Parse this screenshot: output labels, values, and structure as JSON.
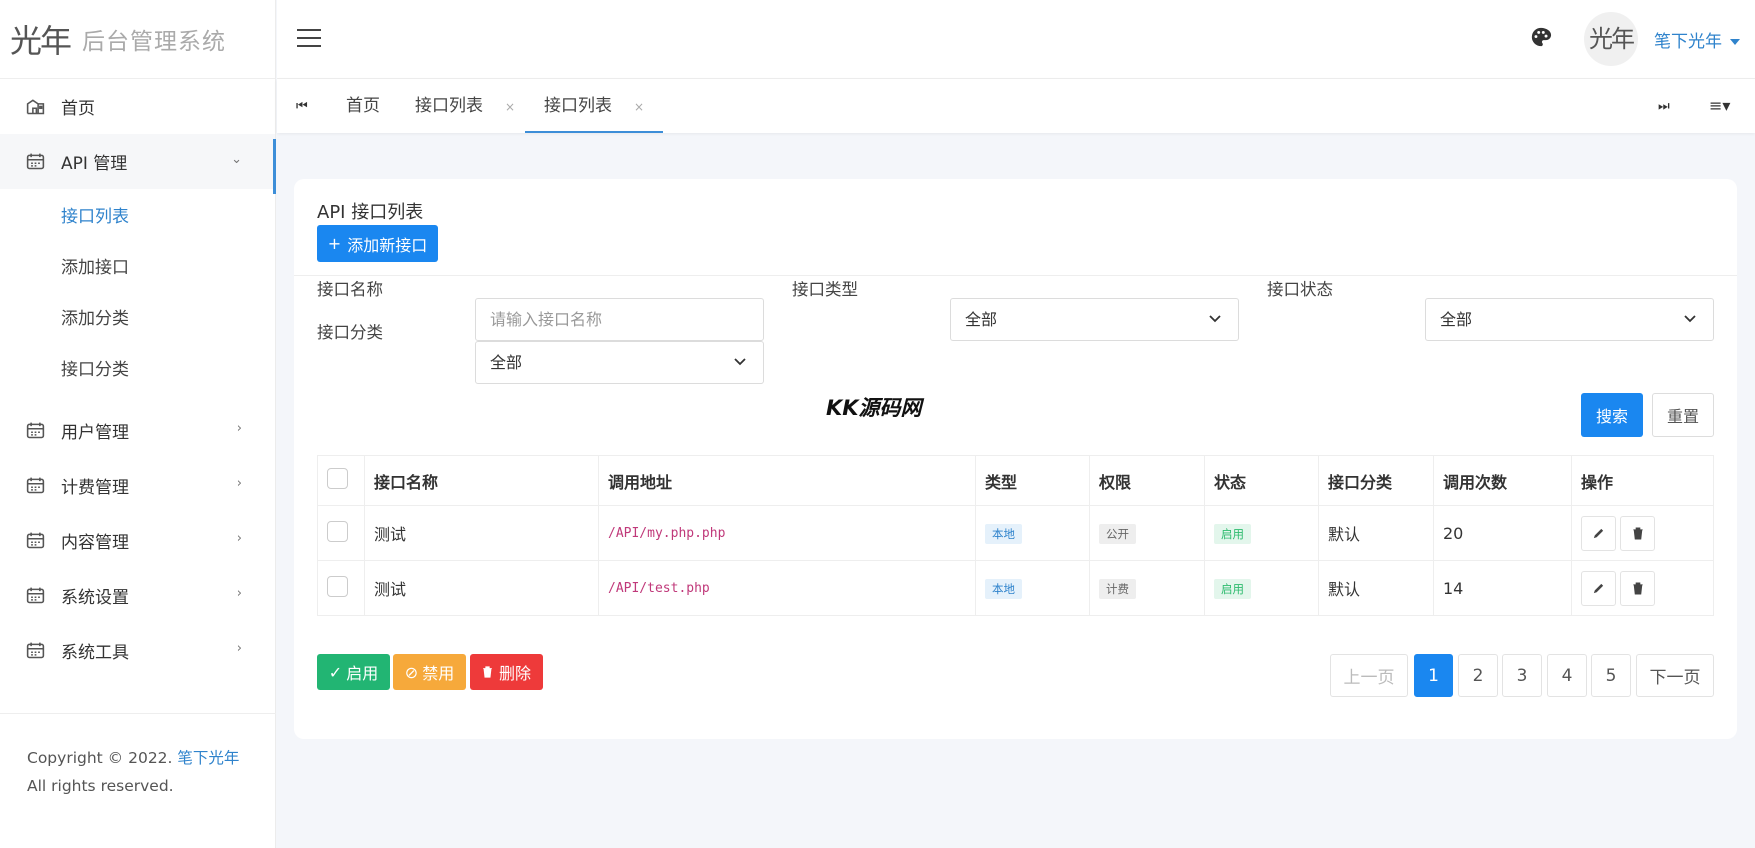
{
  "app": {
    "logo_glyph": "光年",
    "title": "后台管理系统"
  },
  "sidebar": {
    "items": [
      {
        "label": "首页",
        "icon": "home-icon"
      },
      {
        "label": "API 管理",
        "icon": "api-icon",
        "expanded": true,
        "children": [
          {
            "label": "接口列表",
            "active": true
          },
          {
            "label": "添加接口"
          },
          {
            "label": "添加分类"
          },
          {
            "label": "接口分类"
          }
        ]
      },
      {
        "label": "用户管理",
        "icon": "users-icon"
      },
      {
        "label": "计费管理",
        "icon": "billing-icon"
      },
      {
        "label": "内容管理",
        "icon": "content-icon"
      },
      {
        "label": "系统设置",
        "icon": "settings-icon"
      },
      {
        "label": "系统工具",
        "icon": "tools-icon"
      }
    ],
    "footer": {
      "prefix": "Copyright © 2022.",
      "link": "笔下光年",
      "suffix": "All rights reserved."
    }
  },
  "header": {
    "avatar_text": "光年",
    "username": "笔下光年"
  },
  "tabs": [
    {
      "label": "首页",
      "closable": false
    },
    {
      "label": "接口列表",
      "closable": true
    },
    {
      "label": "接口列表",
      "closable": true,
      "active": true
    }
  ],
  "card": {
    "title": "API 接口列表",
    "add_button": "添加新接口"
  },
  "filters": {
    "name": {
      "label": "接口名称",
      "placeholder": "请输入接口名称"
    },
    "type": {
      "label": "接口类型",
      "value": "全部"
    },
    "status": {
      "label": "接口状态",
      "value": "全部"
    },
    "category": {
      "label": "接口分类",
      "value": "全部"
    },
    "search_button": "搜索",
    "reset_button": "重置"
  },
  "watermark": "KK源码网",
  "table": {
    "columns": [
      "接口名称",
      "调用地址",
      "类型",
      "权限",
      "状态",
      "接口分类",
      "调用次数",
      "操作"
    ],
    "rows": [
      {
        "name": "测试",
        "url": "/API/my.php.php",
        "type": "本地",
        "permission": "公开",
        "status": "启用",
        "category": "默认",
        "calls": "20"
      },
      {
        "name": "测试",
        "url": "/API/test.php",
        "type": "本地",
        "permission": "计费",
        "status": "启用",
        "category": "默认",
        "calls": "14"
      }
    ]
  },
  "bulk": {
    "enable": "启用",
    "disable": "禁用",
    "delete": "删除"
  },
  "pagination": {
    "prev": "上一页",
    "pages": [
      "1",
      "2",
      "3",
      "4",
      "5"
    ],
    "current": "1",
    "next": "下一页"
  },
  "colors": {
    "primary": "#1a87f0",
    "link": "#2f83cc",
    "success": "#22b573",
    "warning": "#f6a93b",
    "danger": "#ee3a3a"
  }
}
